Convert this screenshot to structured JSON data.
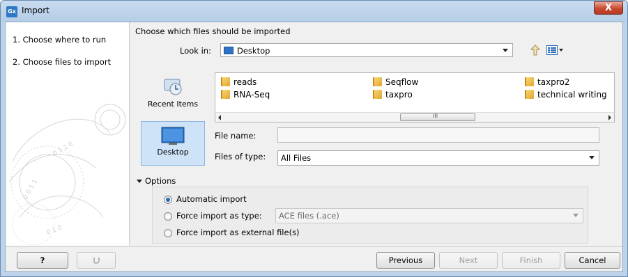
{
  "window": {
    "title": "Import",
    "app_icon_text": "Gx",
    "close_glyph": "X"
  },
  "steps": [
    {
      "label": "1.  Choose where to run"
    },
    {
      "label": "2.  Choose files to import"
    }
  ],
  "chooser": {
    "heading": "Choose which files should be imported",
    "look_in_label": "Look in:",
    "look_in_value": "Desktop",
    "places": [
      {
        "label": "Recent Items",
        "icon": "recent-items-icon"
      },
      {
        "label": "Desktop",
        "icon": "desktop-icon"
      }
    ],
    "files": [
      {
        "name": "reads"
      },
      {
        "name": "RNA-Seq"
      },
      {
        "name": "Seqflow"
      },
      {
        "name": "taxpro"
      },
      {
        "name": "taxpro2"
      },
      {
        "name": "technical writing"
      }
    ],
    "scroll_grip": "III",
    "file_name_label": "File name:",
    "file_name_value": "",
    "files_of_type_label": "Files of type:",
    "files_of_type_value": "All Files"
  },
  "options": {
    "header": "Options",
    "automatic_import": "Automatic import",
    "force_type_label": "Force import as type:",
    "force_type_value": "ACE files (.ace)",
    "force_external": "Force import as external file(s)",
    "selected": "automatic_import"
  },
  "buttons": {
    "help": "?",
    "previous": "Previous",
    "next": "Next",
    "finish": "Finish",
    "cancel": "Cancel"
  },
  "colors": {
    "accent": "#2a6ab8",
    "title_bar": "#bcd3ea",
    "close": "#c74a30"
  }
}
